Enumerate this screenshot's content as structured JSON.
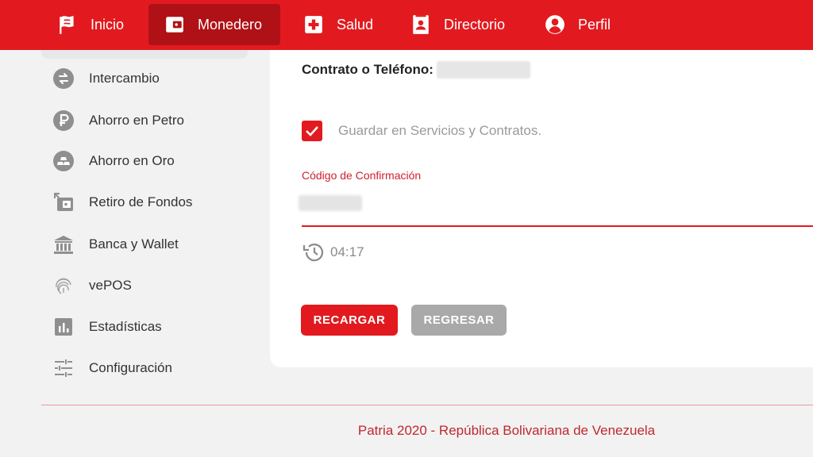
{
  "nav": {
    "items": [
      {
        "label": "Inicio",
        "icon": "flag-icon"
      },
      {
        "label": "Monedero",
        "icon": "wallet-icon",
        "active": true
      },
      {
        "label": "Salud",
        "icon": "health-cross-icon"
      },
      {
        "label": "Directorio",
        "icon": "contact-book-icon"
      },
      {
        "label": "Perfil",
        "icon": "user-icon"
      }
    ]
  },
  "sidebar": {
    "items": [
      {
        "label": "Intercambio",
        "icon": "exchange-icon"
      },
      {
        "label": "Ahorro en Petro",
        "icon": "petro-icon"
      },
      {
        "label": "Ahorro en Oro",
        "icon": "gold-icon"
      },
      {
        "label": "Retiro de Fondos",
        "icon": "withdraw-icon"
      },
      {
        "label": "Banca y Wallet",
        "icon": "bank-icon"
      },
      {
        "label": "vePOS",
        "icon": "fingerprint-icon"
      },
      {
        "label": "Estadísticas",
        "icon": "stats-icon"
      },
      {
        "label": "Configuración",
        "icon": "settings-sliders-icon"
      }
    ]
  },
  "form": {
    "contract_label": "Contrato o Teléfono:",
    "save_label": "Guardar en Servicios y Contratos.",
    "save_checked": true,
    "code_label": "Código de Confirmación",
    "timer": "04:17",
    "reload_button": "RECARGAR",
    "back_button": "REGRESAR"
  },
  "footer": {
    "text": "Patria 2020 - República Bolivariana de Venezuela"
  },
  "colors": {
    "brand": "#e21a1f",
    "active_nav": "#b01116",
    "secondary_button": "#a9a9a9",
    "footer_text": "#c0282e"
  }
}
